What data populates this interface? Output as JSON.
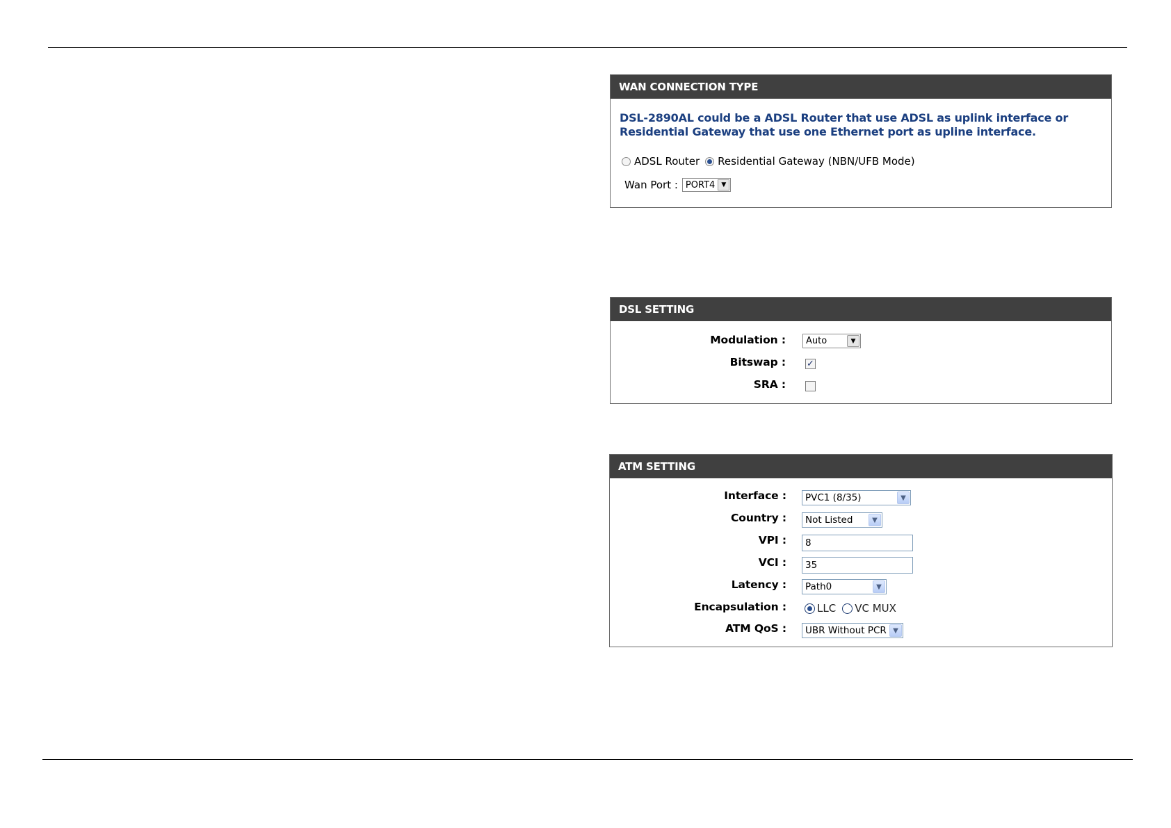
{
  "wan": {
    "title": "WAN CONNECTION TYPE",
    "description": "DSL-2890AL could be a ADSL Router that use ADSL as uplink interface or Residential Gateway that use one Ethernet port as upline interface.",
    "mode_options": [
      {
        "label": "ADSL Router",
        "selected": false
      },
      {
        "label": "Residential Gateway (NBN/UFB Mode)",
        "selected": true
      }
    ],
    "wan_port_label": "Wan Port :",
    "wan_port_value": "PORT4"
  },
  "dsl": {
    "title": "DSL SETTING",
    "modulation_label": "Modulation",
    "modulation_value": "Auto",
    "bitswap_label": "Bitswap",
    "bitswap_checked": true,
    "sra_label": "SRA",
    "sra_checked": false,
    "colon": ":"
  },
  "atm": {
    "title": "ATM SETTING",
    "interface_label": "Interface",
    "interface_value": "PVC1 (8/35)",
    "country_label": "Country",
    "country_value": "Not Listed",
    "vpi_label": "VPI",
    "vpi_value": "8",
    "vci_label": "VCI",
    "vci_value": "35",
    "latency_label": "Latency",
    "latency_value": "Path0",
    "encapsulation_label": "Encapsulation",
    "encapsulation_options": [
      {
        "label": "LLC",
        "selected": true
      },
      {
        "label": "VC MUX",
        "selected": false
      }
    ],
    "qos_label": "ATM QoS",
    "qos_value": "UBR Without PCR",
    "colon": ":"
  }
}
